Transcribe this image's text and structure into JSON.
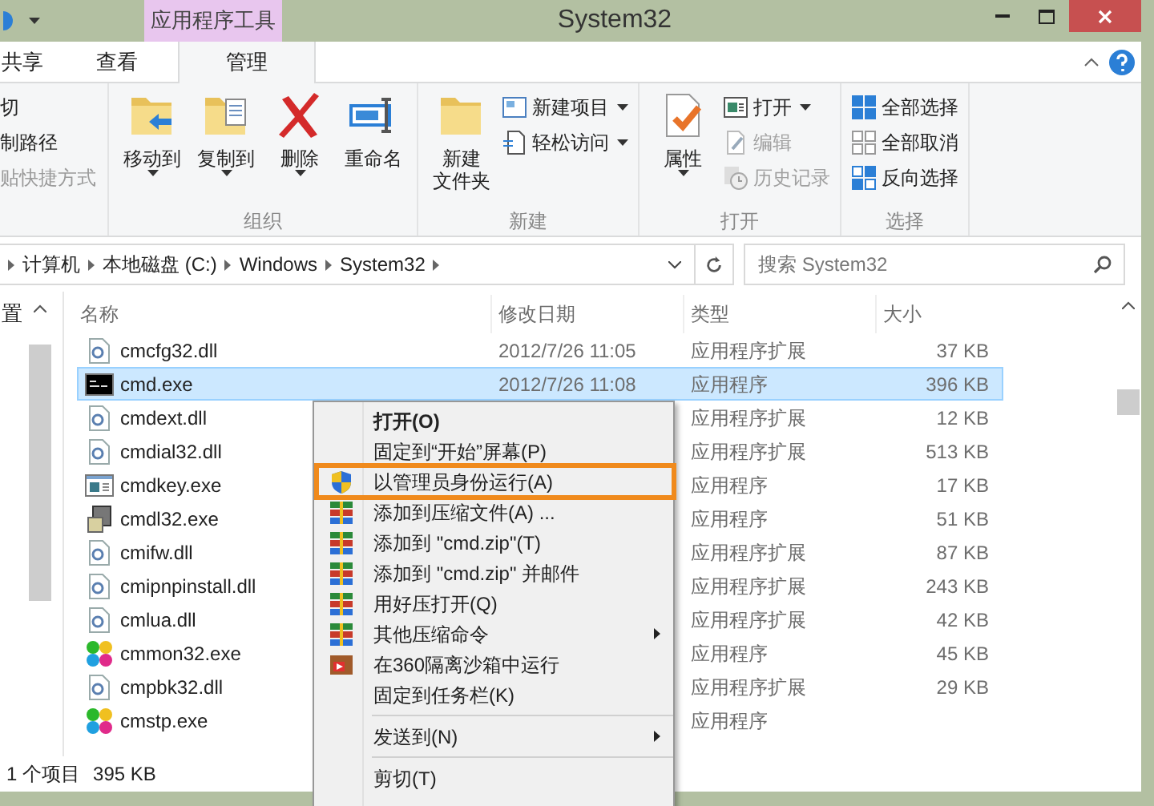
{
  "window": {
    "title": "System32",
    "context_tab": "应用程序工具"
  },
  "tabs": [
    {
      "label": "共享",
      "selected": false
    },
    {
      "label": "查看",
      "selected": false
    },
    {
      "label": "管理",
      "selected": true
    }
  ],
  "ribbon": {
    "clipboard": [
      {
        "label": "切",
        "disabled": false
      },
      {
        "label": "制路径",
        "disabled": false
      },
      {
        "label": "贴快捷方式",
        "disabled": true
      }
    ],
    "groups": [
      {
        "label": "组织",
        "buttons": [
          {
            "lines": [
              "移动到"
            ],
            "dropdown": true
          },
          {
            "lines": [
              "复制到"
            ],
            "dropdown": true
          },
          {
            "lines": [
              "删除"
            ],
            "dropdown": true
          },
          {
            "lines": [
              "重命名"
            ],
            "dropdown": false
          }
        ]
      },
      {
        "label": "新建",
        "buttons": [
          {
            "lines": [
              "新建",
              "文件夹"
            ],
            "dropdown": false
          }
        ],
        "small": [
          {
            "label": "新建项目",
            "dropdown": true,
            "disabled": false
          },
          {
            "label": "轻松访问",
            "dropdown": true,
            "disabled": false
          }
        ]
      },
      {
        "label": "打开",
        "buttons": [
          {
            "lines": [
              "属性"
            ],
            "dropdown": true
          }
        ],
        "small": [
          {
            "label": "打开",
            "dropdown": true,
            "disabled": false
          },
          {
            "label": "编辑",
            "dropdown": false,
            "disabled": true
          },
          {
            "label": "历史记录",
            "dropdown": false,
            "disabled": true
          }
        ]
      },
      {
        "label": "选择",
        "small": [
          {
            "label": "全部选择",
            "dropdown": false,
            "disabled": false
          },
          {
            "label": "全部取消",
            "dropdown": false,
            "disabled": false
          },
          {
            "label": "反向选择",
            "dropdown": false,
            "disabled": false
          }
        ]
      }
    ]
  },
  "address": {
    "path": [
      "计算机",
      "本地磁盘 (C:)",
      "Windows",
      "System32"
    ],
    "search_placeholder": "搜索 System32"
  },
  "nav_pane": {
    "label": "置"
  },
  "table": {
    "columns": [
      "名称",
      "修改日期",
      "类型",
      "大小"
    ],
    "rows": [
      {
        "name": "cmcfg32.dll",
        "kind": "dll",
        "date": "2012/7/26 11:05",
        "type": "应用程序扩展",
        "size": "37 KB",
        "selected": false
      },
      {
        "name": "cmd.exe",
        "kind": "console",
        "date": "2012/7/26 11:08",
        "type": "应用程序",
        "size": "396 KB",
        "selected": true
      },
      {
        "name": "cmdext.dll",
        "kind": "dll",
        "type": "应用程序扩展",
        "size": "12 KB",
        "selected": false
      },
      {
        "name": "cmdial32.dll",
        "kind": "dll",
        "type": "应用程序扩展",
        "size": "513 KB",
        "selected": false
      },
      {
        "name": "cmdkey.exe",
        "kind": "app",
        "type": "应用程序",
        "size": "17 KB",
        "selected": false
      },
      {
        "name": "cmdl32.exe",
        "kind": "setup",
        "type": "应用程序",
        "size": "51 KB",
        "selected": false
      },
      {
        "name": "cmifw.dll",
        "kind": "dll",
        "type": "应用程序扩展",
        "size": "87 KB",
        "selected": false
      },
      {
        "name": "cmipnpinstall.dll",
        "kind": "dll",
        "type": "应用程序扩展",
        "size": "243 KB",
        "selected": false
      },
      {
        "name": "cmlua.dll",
        "kind": "dll",
        "type": "应用程序扩展",
        "size": "42 KB",
        "selected": false
      },
      {
        "name": "cmmon32.exe",
        "kind": "colorful",
        "type": "应用程序",
        "size": "45 KB",
        "selected": false
      },
      {
        "name": "cmpbk32.dll",
        "kind": "dll",
        "type": "应用程序扩展",
        "size": "29 KB",
        "selected": false
      },
      {
        "name": "cmstp.exe",
        "kind": "colorful",
        "type": "应用程序",
        "selected": false
      }
    ]
  },
  "status_bar": {
    "count": "1 个项目",
    "size": "395 KB"
  },
  "context_menu": [
    {
      "kind": "item",
      "label": "打开(O)",
      "bold": true,
      "submenu": false,
      "highlighted": false
    },
    {
      "kind": "item",
      "label": "固定到“开始”屏幕(P)",
      "bold": false,
      "submenu": false,
      "highlighted": false
    },
    {
      "kind": "item",
      "label": "以管理员身份运行(A)",
      "bold": false,
      "submenu": false,
      "highlighted": true
    },
    {
      "kind": "item",
      "label": "添加到压缩文件(A) ...",
      "bold": false,
      "submenu": false,
      "highlighted": false
    },
    {
      "kind": "item",
      "label": "添加到 \"cmd.zip\"(T)",
      "bold": false,
      "submenu": false,
      "highlighted": false
    },
    {
      "kind": "item",
      "label": "添加到 \"cmd.zip\" 并邮件",
      "bold": false,
      "submenu": false,
      "highlighted": false
    },
    {
      "kind": "item",
      "label": "用好压打开(Q)",
      "bold": false,
      "submenu": false,
      "highlighted": false
    },
    {
      "kind": "item",
      "label": "其他压缩命令",
      "bold": false,
      "submenu": true,
      "highlighted": false
    },
    {
      "kind": "item",
      "label": "在360隔离沙箱中运行",
      "bold": false,
      "submenu": false,
      "highlighted": false
    },
    {
      "kind": "item",
      "label": "固定到任务栏(K)",
      "bold": false,
      "submenu": false,
      "highlighted": false
    },
    {
      "kind": "separator"
    },
    {
      "kind": "item",
      "label": "发送到(N)",
      "bold": false,
      "submenu": true,
      "highlighted": false
    },
    {
      "kind": "separator"
    },
    {
      "kind": "item",
      "label": "剪切(T)",
      "bold": false,
      "submenu": false,
      "highlighted": false
    }
  ]
}
